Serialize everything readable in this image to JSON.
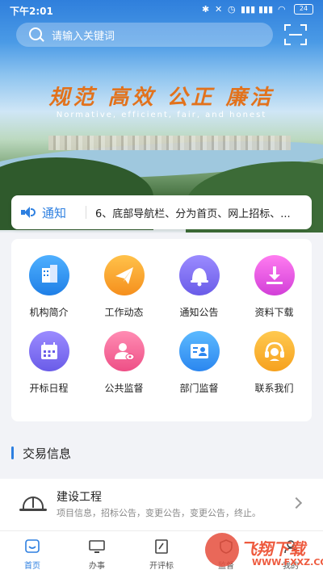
{
  "status": {
    "time": "下午2:01",
    "battery": "24"
  },
  "search": {
    "placeholder": "请输入关键词"
  },
  "hero": {
    "slogan": "规范 高效 公正 廉洁",
    "slogan_en": "Normative, efficient, fair, and honest"
  },
  "notice": {
    "label": "通知",
    "text": "6、底部导航栏、分为首页、网上招标、..."
  },
  "grid": [
    {
      "label": "机构简介",
      "icon": "building-icon",
      "color": "#2b86ef"
    },
    {
      "label": "工作动态",
      "icon": "paper-plane-icon",
      "color": "#f7a12a"
    },
    {
      "label": "通知公告",
      "icon": "bell-icon",
      "color": "#7b6cf0"
    },
    {
      "label": "资料下载",
      "icon": "download-icon",
      "color": "#dc4ae0"
    },
    {
      "label": "开标日程",
      "icon": "calendar-icon",
      "color": "#6a5ce8"
    },
    {
      "label": "公共监督",
      "icon": "user-eye-icon",
      "color": "#ee4f86"
    },
    {
      "label": "部门监督",
      "icon": "id-card-icon",
      "color": "#2b86ef"
    },
    {
      "label": "联系我们",
      "icon": "headset-icon",
      "color": "#f6a11e"
    }
  ],
  "section": {
    "title": "交易信息"
  },
  "trade": {
    "title": "建设工程",
    "subtitle": "项目信息，招标公告，变更公告，变更公告，终止。"
  },
  "nav": [
    {
      "label": "首页",
      "icon": "home-icon",
      "active": true
    },
    {
      "label": "办事",
      "icon": "monitor-icon",
      "active": false
    },
    {
      "label": "开评标",
      "icon": "edit-icon",
      "active": false
    },
    {
      "label": "监督",
      "icon": "shield-icon",
      "active": false
    },
    {
      "label": "我的",
      "icon": "user-icon",
      "active": false
    }
  ],
  "watermark": {
    "text": "飞翔下载",
    "sub": "WWW.FXXZ.COM"
  }
}
